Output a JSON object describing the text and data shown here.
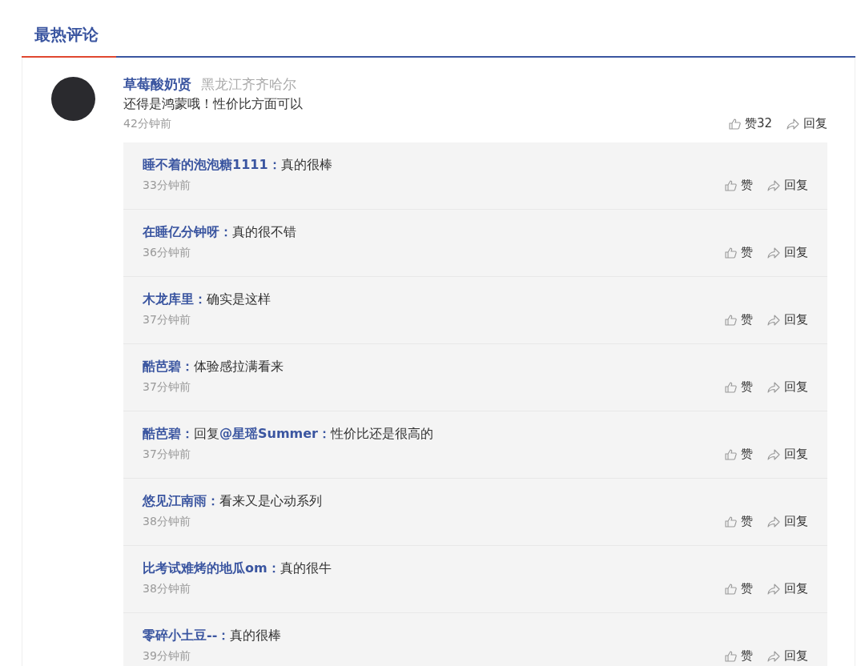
{
  "section_title": "最热评论",
  "comment": {
    "author": "草莓酸奶贤",
    "location": "黑龙江齐齐哈尔",
    "text": "还得是鸿蒙哦！性价比方面可以",
    "time": "42分钟前",
    "like_label": "赞32",
    "reply_label": "回复"
  },
  "replies": [
    {
      "author": "睡不着的泡泡糖1111：",
      "text": "真的很棒",
      "time": "33分钟前",
      "like_label": "赞",
      "reply_label": "回复"
    },
    {
      "author": "在睡亿分钟呀：",
      "text": "真的很不错",
      "time": "36分钟前",
      "like_label": "赞",
      "reply_label": "回复"
    },
    {
      "author": "木龙库里：",
      "text": "确实是这样",
      "time": "37分钟前",
      "like_label": "赞",
      "reply_label": "回复"
    },
    {
      "author": "酷芭碧：",
      "text": "体验感拉满看来",
      "time": "37分钟前",
      "like_label": "赞",
      "reply_label": "回复"
    },
    {
      "author": "酷芭碧：",
      "text": "回复**@星瑶Summer：**性价比还是很高的",
      "time": "37分钟前",
      "like_label": "赞",
      "reply_label": "回复"
    },
    {
      "author": "悠见江南雨：",
      "text": "看来又是心动系列",
      "time": "38分钟前",
      "like_label": "赞",
      "reply_label": "回复"
    },
    {
      "author": "比考试难烤的地瓜om：",
      "text": "真的很牛",
      "time": "38分钟前",
      "like_label": "赞",
      "reply_label": "回复"
    },
    {
      "author": "零碎小土豆--：",
      "text": "真的很棒",
      "time": "39分钟前",
      "like_label": "赞",
      "reply_label": "回复"
    }
  ]
}
